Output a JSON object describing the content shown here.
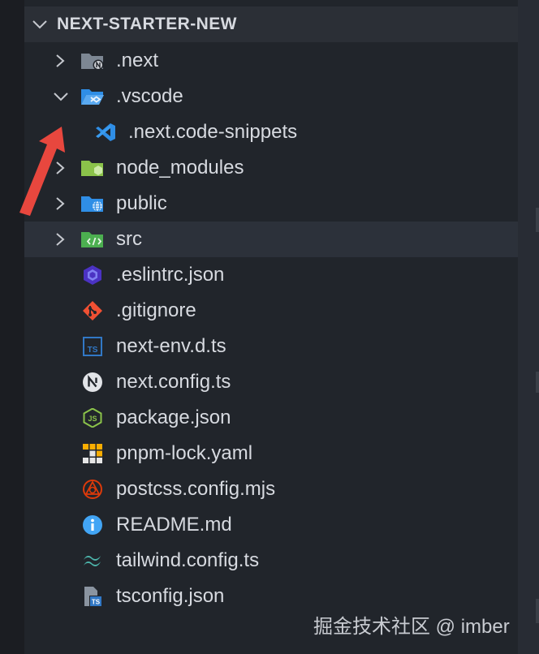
{
  "explorer": {
    "root_title": "NEXT-STARTER-NEW",
    "items": [
      {
        "label": ".next",
        "icon": "next-folder-icon"
      },
      {
        "label": ".vscode",
        "icon": "vscode-folder-open-icon"
      },
      {
        "label": ".next.code-snippets",
        "icon": "vscode-file-icon"
      },
      {
        "label": "node_modules",
        "icon": "node-folder-icon"
      },
      {
        "label": "public",
        "icon": "public-folder-icon"
      },
      {
        "label": "src",
        "icon": "src-folder-icon"
      },
      {
        "label": ".eslintrc.json",
        "icon": "eslint-icon"
      },
      {
        "label": ".gitignore",
        "icon": "git-icon"
      },
      {
        "label": "next-env.d.ts",
        "icon": "typescript-icon"
      },
      {
        "label": "next.config.ts",
        "icon": "nextjs-icon"
      },
      {
        "label": "package.json",
        "icon": "nodejs-icon"
      },
      {
        "label": "pnpm-lock.yaml",
        "icon": "pnpm-icon"
      },
      {
        "label": "postcss.config.mjs",
        "icon": "postcss-icon"
      },
      {
        "label": "README.md",
        "icon": "info-icon"
      },
      {
        "label": "tailwind.config.ts",
        "icon": "tailwind-icon"
      },
      {
        "label": "tsconfig.json",
        "icon": "tsconfig-icon"
      }
    ]
  },
  "watermark": "掘金技术社区 @ imber",
  "colors": {
    "sidebar_bg": "#21252b",
    "header_bg": "#2b2f36",
    "selected_bg": "#2c313a",
    "text": "#d7dae0",
    "arrow": "#e8473e",
    "vscode_blue": "#2f8ee6",
    "node_green": "#8bc34a",
    "eslint_purple": "#4b32c3",
    "git_orange": "#f05033"
  }
}
